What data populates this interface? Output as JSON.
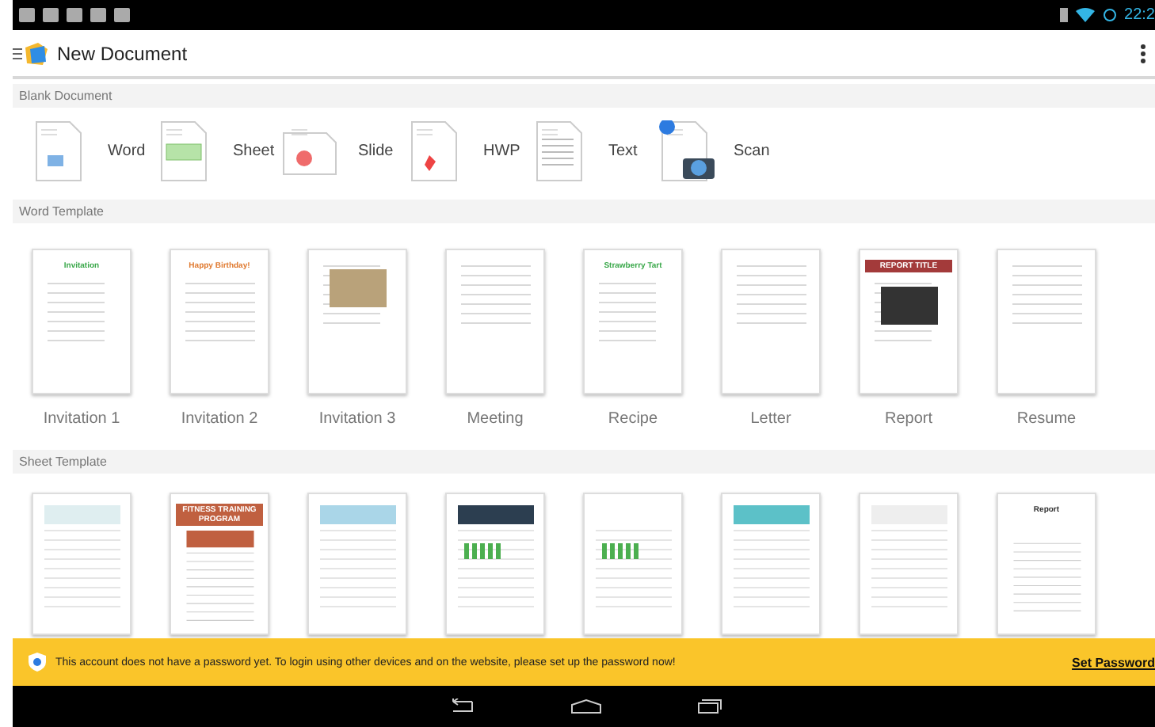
{
  "status_bar": {
    "time": "22:2"
  },
  "app_bar": {
    "title": "New Document"
  },
  "blank_document": {
    "header": "Blank Document",
    "items": [
      {
        "kind": "word",
        "label": "Word"
      },
      {
        "kind": "sheet",
        "label": "Sheet"
      },
      {
        "kind": "slide",
        "label": "Slide"
      },
      {
        "kind": "hwp",
        "label": "HWP"
      },
      {
        "kind": "text",
        "label": "Text"
      },
      {
        "kind": "scan",
        "label": "Scan"
      }
    ]
  },
  "word_template": {
    "header": "Word Template",
    "items": [
      {
        "label": "Invitation 1",
        "preview_title": "Invitation"
      },
      {
        "label": "Invitation 2",
        "preview_title": "Happy Birthday!"
      },
      {
        "label": "Invitation 3"
      },
      {
        "label": "Meeting"
      },
      {
        "label": "Recipe",
        "preview_title": "Strawberry Tart"
      },
      {
        "label": "Letter"
      },
      {
        "label": "Report",
        "preview_title": "REPORT TITLE"
      },
      {
        "label": "Resume"
      }
    ]
  },
  "sheet_template": {
    "header": "Sheet Template",
    "items": [
      {
        "kind": "sheet"
      },
      {
        "kind": "sheet",
        "preview_title": "FITNESS TRAINING PROGRAM"
      },
      {
        "kind": "sheet"
      },
      {
        "kind": "sheet"
      },
      {
        "kind": "sheet"
      },
      {
        "kind": "sheet"
      },
      {
        "kind": "sheet"
      },
      {
        "kind": "sheet",
        "preview_title": "Report"
      }
    ]
  },
  "banner": {
    "message": "This account does not have a password yet. To login using other devices and on the website, please set up the password now!",
    "link": "Set Password"
  }
}
